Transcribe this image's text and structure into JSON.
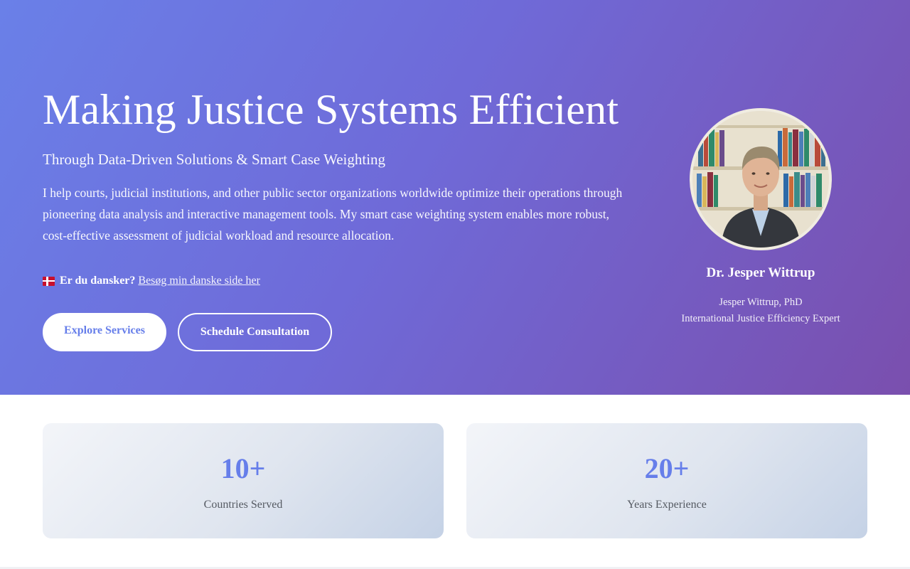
{
  "hero": {
    "title": "Making Justice Systems Efficient",
    "subtitle": "Through Data-Driven Solutions & Smart Case Weighting",
    "description": "I help courts, judicial institutions, and other public sector organizations worldwide optimize their operations through pioneering data analysis and interactive management tools. My smart case weighting system enables more robust, cost-effective assessment of judicial workload and resource allocation.",
    "danish": {
      "flag_icon": "denmark-flag-icon",
      "question": "Er du dansker?",
      "link": "Besøg min danske side her"
    },
    "buttons": {
      "explore": "Explore Services",
      "consult": "Schedule Consultation"
    }
  },
  "profile": {
    "name": "Dr. Jesper Wittrup",
    "credential": "Jesper Wittrup, PhD",
    "role": "International Justice Efficiency Expert"
  },
  "stats": [
    {
      "value": "10+",
      "label": "Countries Served"
    },
    {
      "value": "20+",
      "label": "Years Experience"
    }
  ],
  "colors": {
    "accent": "#667eea",
    "gradient_start": "#6a80e8",
    "gradient_end": "#7a4fae"
  }
}
